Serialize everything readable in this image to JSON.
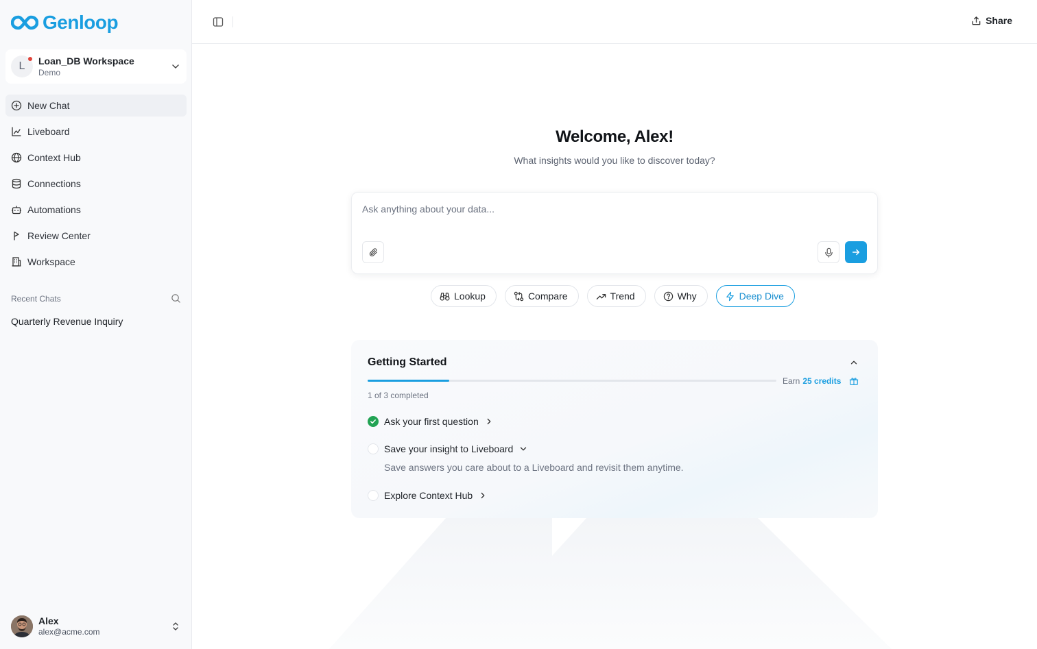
{
  "brand": {
    "name": "Genloop",
    "color": "#1a9ee0"
  },
  "workspace": {
    "initial": "L",
    "name": "Loan_DB Workspace",
    "subtitle": "Demo"
  },
  "nav": [
    {
      "label": "New Chat",
      "icon": "plus-circle-icon"
    },
    {
      "label": "Liveboard",
      "icon": "chart-icon"
    },
    {
      "label": "Context Hub",
      "icon": "globe-icon"
    },
    {
      "label": "Connections",
      "icon": "database-icon"
    },
    {
      "label": "Automations",
      "icon": "robot-icon"
    },
    {
      "label": "Review Center",
      "icon": "flag-icon"
    },
    {
      "label": "Workspace",
      "icon": "building-icon"
    }
  ],
  "recent": {
    "title": "Recent Chats",
    "items": [
      "Quarterly Revenue Inquiry"
    ]
  },
  "user": {
    "name": "Alex",
    "email": "alex@acme.com"
  },
  "topbar": {
    "share_label": "Share"
  },
  "main": {
    "welcome": "Welcome, Alex!",
    "subtitle": "What insights would you like to discover today?",
    "ask_placeholder": "Ask anything about your data..."
  },
  "chips": [
    "Lookup",
    "Compare",
    "Trend",
    "Why",
    "Deep Dive"
  ],
  "getting_started": {
    "title": "Getting Started",
    "progress": 0.2,
    "earn_prefix": "Earn",
    "earn_credits": "25 credits",
    "completed": "1 of 3 completed",
    "tasks": [
      {
        "label": "Ask your first question",
        "done": true
      },
      {
        "label": "Save your insight to Liveboard",
        "done": false,
        "description": "Save answers you care about to a Liveboard and revisit them anytime."
      },
      {
        "label": "Explore Context Hub",
        "done": false
      }
    ]
  }
}
